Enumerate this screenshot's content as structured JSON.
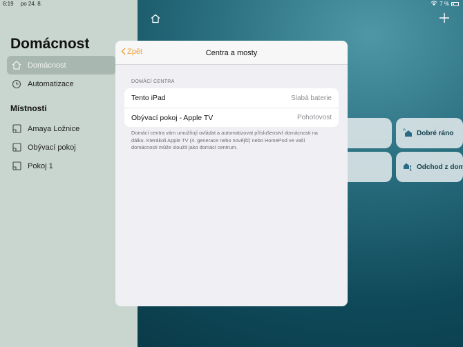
{
  "status_bar": {
    "time": "6:19",
    "date": "po 24. 8.",
    "battery": "7 %"
  },
  "sidebar": {
    "title": "Domácnost",
    "items": [
      {
        "label": "Domácnost",
        "icon": "house-icon",
        "active": true
      },
      {
        "label": "Automatizace",
        "icon": "clock-icon",
        "active": false
      }
    ],
    "rooms_title": "Místnosti",
    "rooms": [
      {
        "label": "Amaya Ložnice",
        "icon": "room-icon"
      },
      {
        "label": "Obývací pokoj",
        "icon": "room-icon"
      },
      {
        "label": "Pokoj 1",
        "icon": "room-icon"
      }
    ]
  },
  "main": {
    "scenes": [
      {
        "label": "Dobré ráno",
        "icon": "sunrise-house-icon"
      },
      {
        "label": "Odchod z domu",
        "icon": "leave-house-icon"
      }
    ]
  },
  "modal": {
    "back_label": "Zpět",
    "title": "Centra a mosty",
    "group_label": "DOMÁCÍ CENTRA",
    "rows": [
      {
        "name": "Tento iPad",
        "status": "Slabá baterie"
      },
      {
        "name": "Obývací pokoj - Apple TV",
        "status": "Pohotovost"
      }
    ],
    "footer": "Domácí centra vám umožňují ovládat a automatizovat příslušenství domácnosti na dálku. Kterákoli Apple TV (4. generace nebo novější) nebo HomePod ve vaší domácnosti může sloužit jako domácí centrum."
  },
  "colors": {
    "accent": "#f0a23a",
    "sidebar_bg": "#c8d6cf",
    "modal_bg": "#f0eff4"
  }
}
